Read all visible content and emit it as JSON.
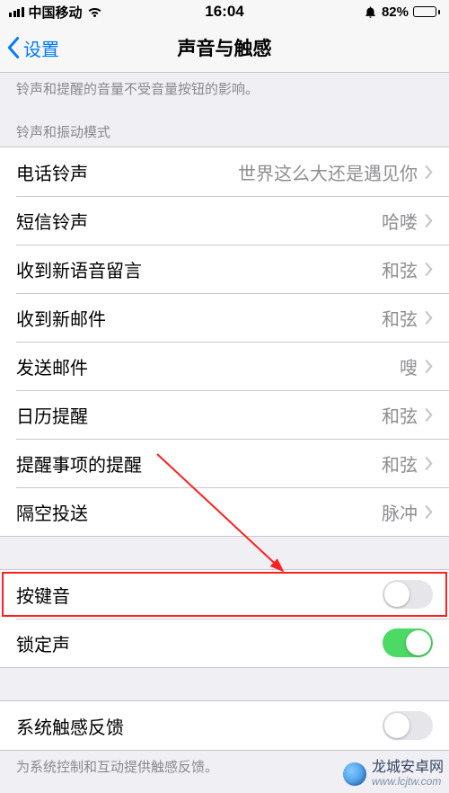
{
  "status": {
    "carrier": "中国移动",
    "time": "16:04",
    "battery_pct": "82%"
  },
  "nav": {
    "back": "设置",
    "title": "声音与触感"
  },
  "hint_top": "铃声和提醒的音量不受音量按钮的影响。",
  "section_header": "铃声和振动模式",
  "sounds": [
    {
      "label": "电话铃声",
      "value": "世界这么大还是遇见你"
    },
    {
      "label": "短信铃声",
      "value": "哈喽"
    },
    {
      "label": "收到新语音留言",
      "value": "和弦"
    },
    {
      "label": "收到新邮件",
      "value": "和弦"
    },
    {
      "label": "发送邮件",
      "value": "嗖"
    },
    {
      "label": "日历提醒",
      "value": "和弦"
    },
    {
      "label": "提醒事项的提醒",
      "value": "和弦"
    },
    {
      "label": "隔空投送",
      "value": "脉冲"
    }
  ],
  "toggles": {
    "keyboard_click": {
      "label": "按键音",
      "on": false
    },
    "lock_sound": {
      "label": "锁定声",
      "on": true
    }
  },
  "haptics": {
    "label": "系统触感反馈",
    "on": false,
    "footer": "为系统控制和互动提供触感反馈。"
  },
  "watermark": {
    "title": "龙城安卓网",
    "url": "www.lcjtw.com"
  }
}
